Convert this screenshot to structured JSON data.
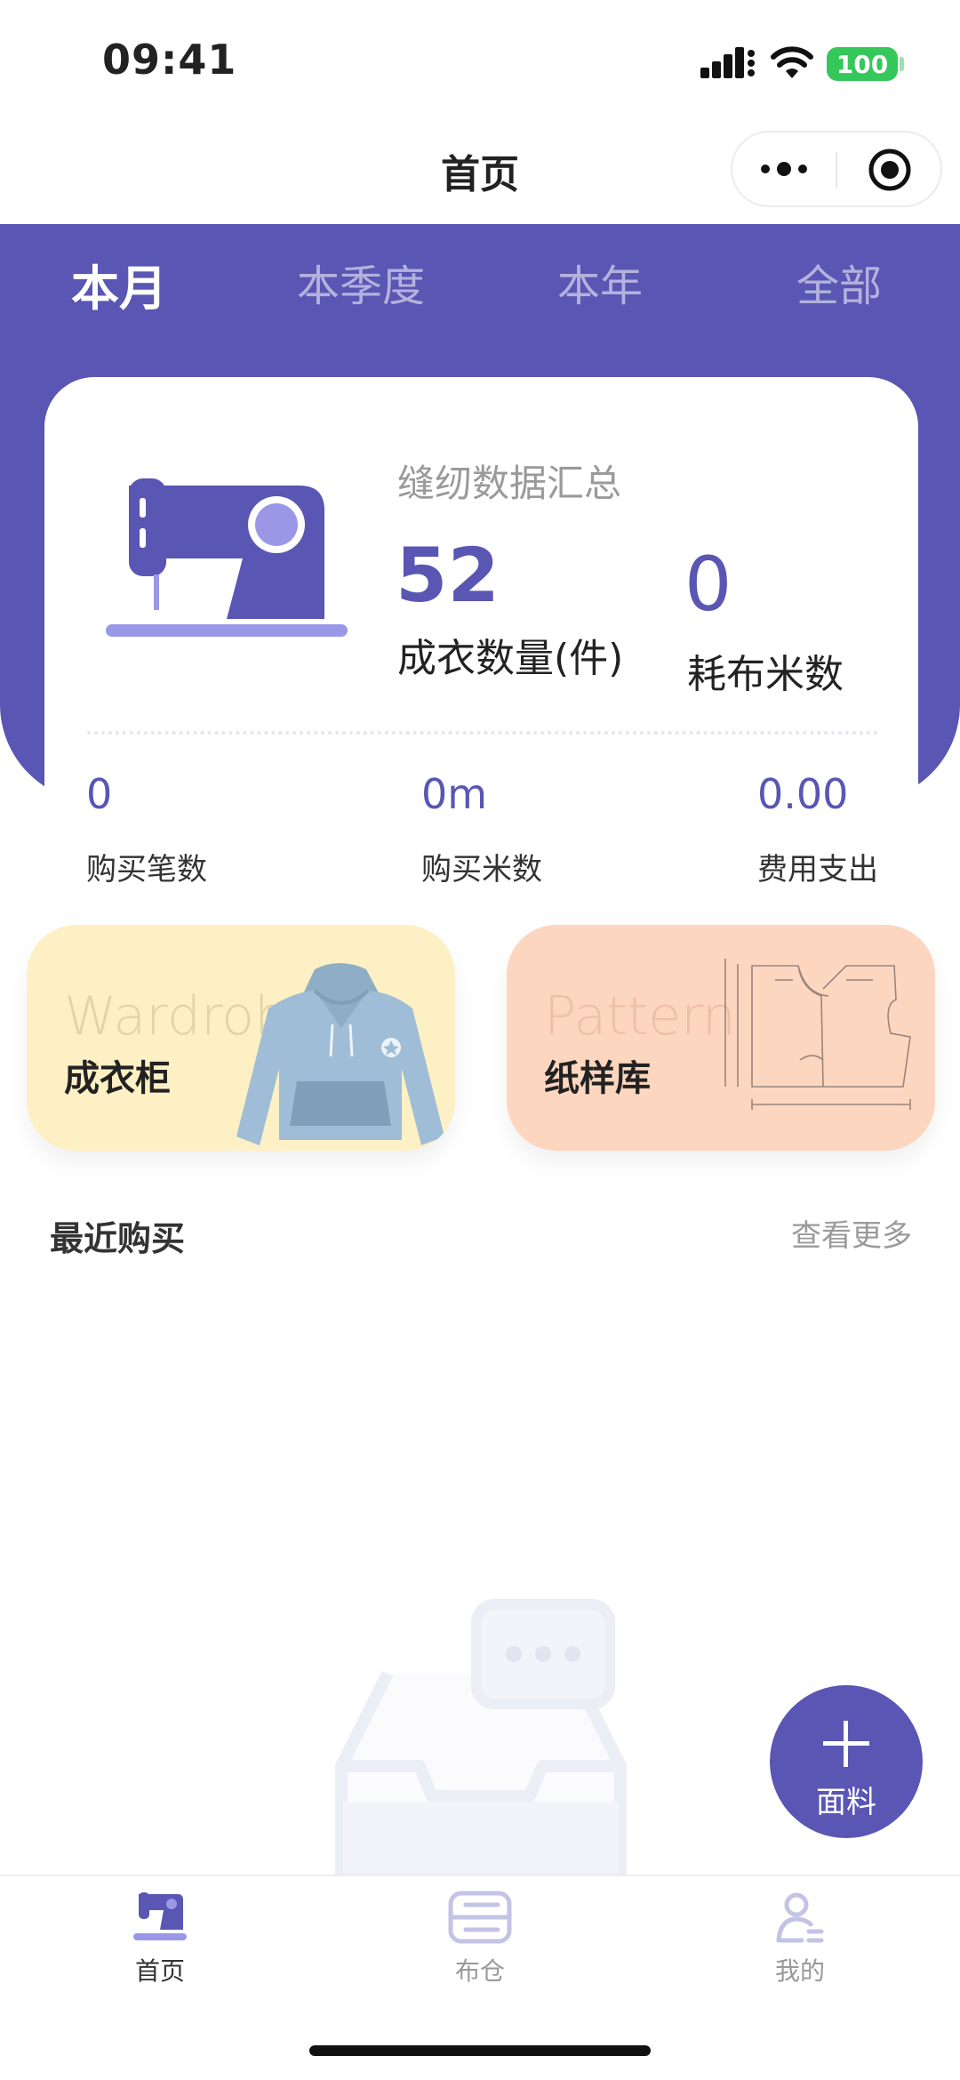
{
  "status_bar": {
    "time": "09:41",
    "battery": "100"
  },
  "nav": {
    "title": "首页"
  },
  "tabs": [
    {
      "label": "本月",
      "active": true
    },
    {
      "label": "本季度",
      "active": false
    },
    {
      "label": "本年",
      "active": false
    },
    {
      "label": "全部",
      "active": false
    }
  ],
  "summary": {
    "title": "缝纫数据汇总",
    "garments": {
      "value": "52",
      "label": "成衣数量(件)"
    },
    "fabric_meters": {
      "value": "0",
      "label": "耗布米数"
    },
    "stats": [
      {
        "value": "0",
        "label": "购买笔数"
      },
      {
        "value": "0m",
        "label": "购买米数"
      },
      {
        "value": "0.00",
        "label": "费用支出"
      }
    ]
  },
  "features": [
    {
      "en": "Wardrobe",
      "cn": "成衣柜",
      "bg": "#fdf0c4"
    },
    {
      "en": "Pattern",
      "cn": "纸样库",
      "bg": "#fdd6c0"
    }
  ],
  "recent": {
    "title": "最近购买",
    "more": "查看更多"
  },
  "fab": {
    "label": "面料"
  },
  "tabbar": [
    {
      "label": "首页",
      "icon": "sewing-machine-icon",
      "active": true
    },
    {
      "label": "布仓",
      "icon": "fabric-stack-icon",
      "active": false
    },
    {
      "label": "我的",
      "icon": "user-icon",
      "active": false
    }
  ],
  "colors": {
    "primary": "#5956b4",
    "light_primary": "#9a98e6"
  }
}
